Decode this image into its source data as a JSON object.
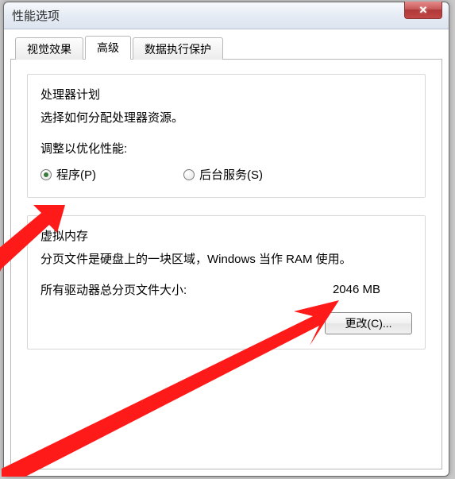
{
  "window": {
    "title": "性能选项"
  },
  "tabs": {
    "visual": "视觉效果",
    "advanced": "高级",
    "dep": "数据执行保护"
  },
  "processor": {
    "title": "处理器计划",
    "desc": "选择如何分配处理器资源。",
    "adjust_label": "调整以优化性能:",
    "opt_programs": "程序(P)",
    "opt_background": "后台服务(S)"
  },
  "vm": {
    "title": "虚拟内存",
    "desc": "分页文件是硬盘上的一块区域，Windows 当作 RAM 使用。",
    "total_label": "所有驱动器总分页文件大小:",
    "total_value": "2046 MB",
    "change_btn": "更改(C)..."
  }
}
